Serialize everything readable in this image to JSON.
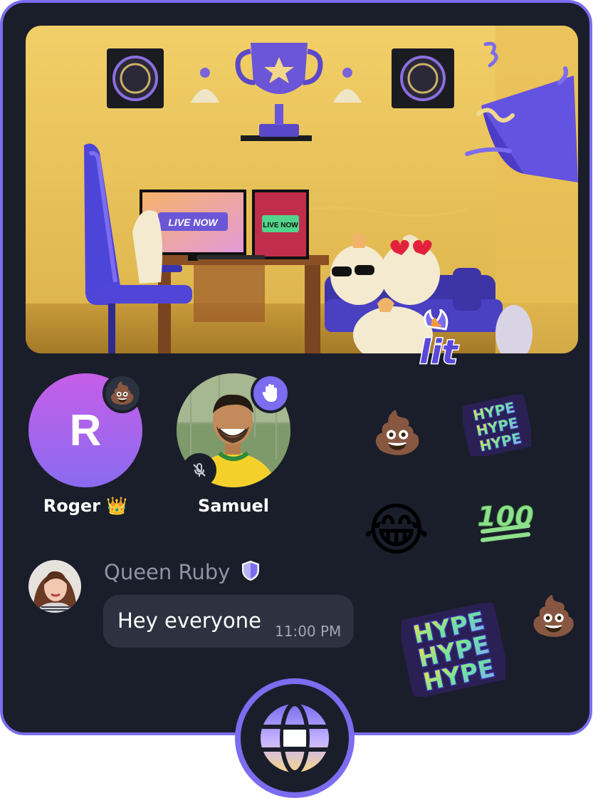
{
  "stream": {
    "monitor_left_text": "LIVE NOW",
    "monitor_right_text": "LIVE NOW"
  },
  "participants": [
    {
      "name": "Roger 👑",
      "initial": "R",
      "badge": "poop-emoji",
      "muted": false
    },
    {
      "name": "Samuel",
      "badge": "raised-hand-icon",
      "muted": true
    }
  ],
  "chat": {
    "author": "Queen Ruby",
    "author_badge": "shield-icon",
    "message": "Hey everyone",
    "time": "11:00 PM"
  },
  "stickers": [
    "lit",
    "HYPE HYPE HYPE",
    "poop-emoji",
    "laughing-emoji",
    "100",
    "HYPE HYPE HYPE",
    "poop-emoji"
  ],
  "colors": {
    "accent": "#7b6cf0",
    "background": "#1a1e2b",
    "bubble": "#2d3240",
    "muted_text": "#8f93a3"
  }
}
